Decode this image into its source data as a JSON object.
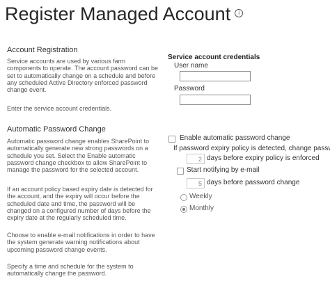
{
  "page": {
    "title": "Register Managed Account",
    "info_icon": "info-icon"
  },
  "account_registration": {
    "heading": "Account Registration",
    "paragraphs": [
      "Service accounts are used by various farm components to operate. The account password can be set to automatically change on a schedule and before any scheduled Active Directory enforced password change event.",
      "Enter the service account credentials."
    ]
  },
  "credentials": {
    "heading": "Service account credentials",
    "username_label": "User name",
    "username_value": "",
    "password_label": "Password",
    "password_value": ""
  },
  "auto_password": {
    "heading": "Automatic Password Change",
    "paragraphs": [
      "Automatic password change enables SharePoint to automatically generate new strong passwords on a schedule you set. Select the Enable automatic password change checkbox to allow SharePoint to manage the password for the selected account.",
      "If an account policy based expiry date is detected for the account, and the expiry will occur before the scheduled date and time, the password will be changed on a configured number of days before the expiry date at the regularly scheduled time.",
      "Choose to enable e-mail notifications in order to have the system generate warning notifications about upcoming password change events.",
      "Specify a time and schedule for the system to automatically change the password."
    ]
  },
  "options": {
    "enable_label": "Enable automatic password change",
    "enable_checked": false,
    "policy_label": "If password expiry policy is detected, change password",
    "expiry_days_value": "2",
    "expiry_days_label": "days before expiry policy is enforced",
    "notify_label": "Start notifying by e-mail",
    "notify_checked": false,
    "notify_days_value": "5",
    "notify_days_label": "days before password change",
    "schedule": {
      "weekly_label": "Weekly",
      "monthly_label": "Monthly",
      "selected": "Monthly"
    }
  }
}
